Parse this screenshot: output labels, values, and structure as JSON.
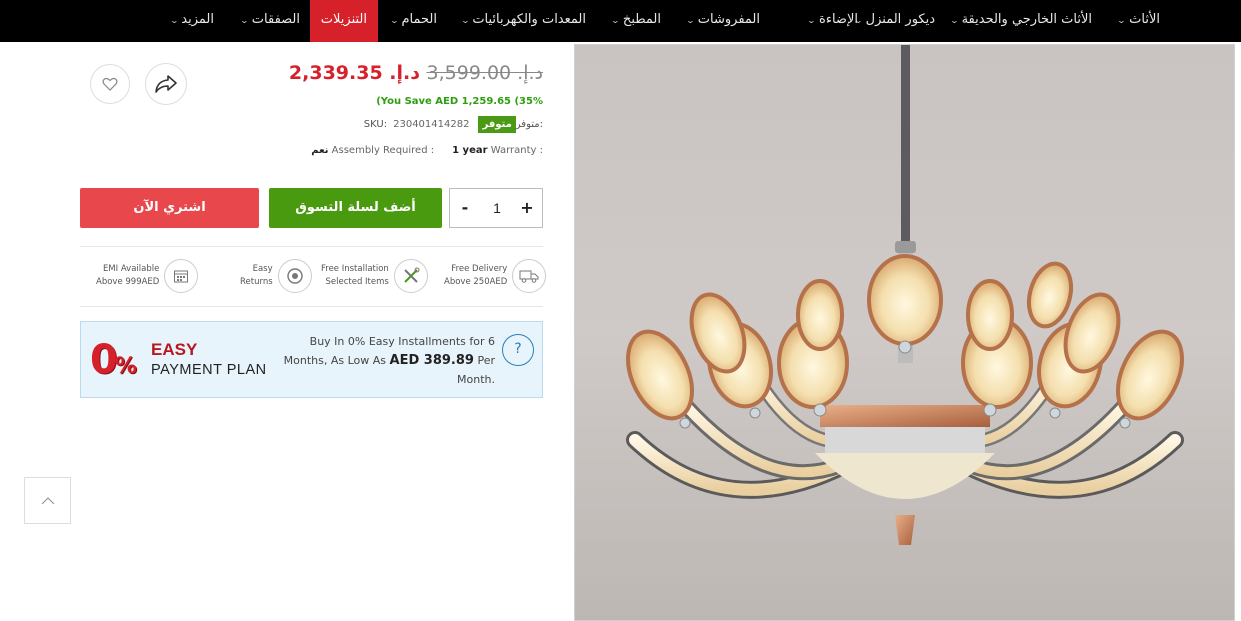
{
  "nav": {
    "items": [
      {
        "label": "الأثاث",
        "chevron": true
      },
      {
        "label": "الأثاث الخارجي والحديقة",
        "chevron": true
      },
      {
        "label": "ديكور المنزل",
        "chevron": true
      },
      {
        "label": "الإضاءة",
        "chevron": true
      },
      {
        "label": "المفروشات",
        "chevron": true
      },
      {
        "label": "المطبخ",
        "chevron": true
      },
      {
        "label": "المعدات والكهربائيات",
        "chevron": true
      },
      {
        "label": "الحمام",
        "chevron": true
      },
      {
        "label": "التنزيلات",
        "chevron": false,
        "active": true
      },
      {
        "label": "الصفقات",
        "chevron": true
      },
      {
        "label": "المزيد",
        "chevron": true
      }
    ]
  },
  "product": {
    "old_price": "د.إ. 3,599.00",
    "new_price": "د.إ. 2,339.35",
    "save_text": "(You Save AED 1,259.65 (35%",
    "stock_label": "متوفر:",
    "stock_badge": "متوفر",
    "sku_label": "SKU:",
    "sku_value": "230401414282",
    "warranty_label": "Warranty :",
    "warranty_value": "1 year",
    "assembly_label": "Assembly Required :",
    "assembly_value": "نعم"
  },
  "actions": {
    "qty_minus": "-",
    "qty_value": "1",
    "qty_plus": "+",
    "add_to_cart": "أضف لسلة التسوق",
    "buy_now": "اشتري الآن"
  },
  "features": [
    {
      "line1": "Free Delivery",
      "line2": "Above 250AED",
      "icon": "truck-icon"
    },
    {
      "line1": "Free Installation",
      "line2": "Selected Items",
      "icon": "tools-icon"
    },
    {
      "line1": "Easy",
      "line2": "Returns",
      "icon": "returns-icon"
    },
    {
      "line1": "EMI Available",
      "line2": "Above 999AED",
      "icon": "calendar-icon"
    }
  ],
  "payment_plan": {
    "logo_zero": "0",
    "logo_pct": "%",
    "easy": "EASY",
    "plan": "PAYMENT PLAN",
    "text_before": "Buy In 0% Easy Installments for 6 Months, As Low As ",
    "amount": "AED 389.89",
    "text_after": " Per Month.",
    "help": "?"
  },
  "colors": {
    "accent_red": "#d6212a",
    "cart_green": "#4a9a10",
    "buy_red": "#e8474b",
    "nav_bg": "#000000"
  }
}
